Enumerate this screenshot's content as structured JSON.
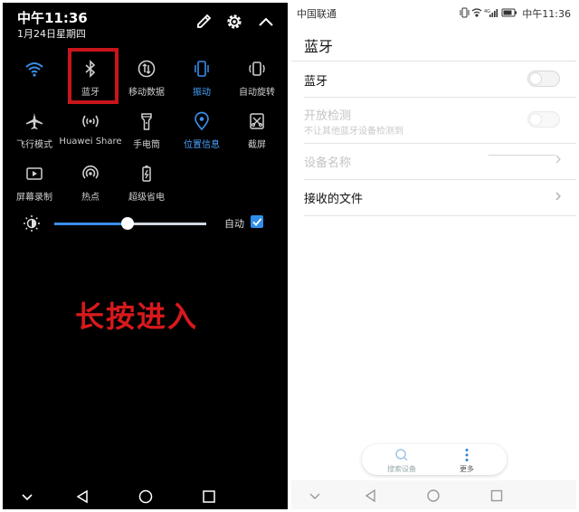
{
  "left": {
    "time": "中午11:36",
    "date": "1月24日星期四",
    "tiles": [
      {
        "label": "",
        "icon": "wifi-icon",
        "active": true
      },
      {
        "label": "蓝牙",
        "icon": "bluetooth-icon",
        "active": false
      },
      {
        "label": "移动数据",
        "icon": "mobile-data-icon",
        "active": false
      },
      {
        "label": "振动",
        "icon": "vibrate-icon",
        "active": true
      },
      {
        "label": "自动旋转",
        "icon": "rotate-icon",
        "active": false
      },
      {
        "label": "飞行模式",
        "icon": "airplane-icon",
        "active": false
      },
      {
        "label": "Huawei Share",
        "icon": "huawei-share-icon",
        "active": false
      },
      {
        "label": "手电筒",
        "icon": "flashlight-icon",
        "active": false
      },
      {
        "label": "位置信息",
        "icon": "location-icon",
        "active": true
      },
      {
        "label": "截屏",
        "icon": "screenshot-icon",
        "active": false
      },
      {
        "label": "屏幕录制",
        "icon": "screen-record-icon",
        "active": false
      },
      {
        "label": "热点",
        "icon": "hotspot-icon",
        "active": false
      },
      {
        "label": "超级省电",
        "icon": "power-saving-icon",
        "active": false
      }
    ],
    "brightness": {
      "level": 0.48,
      "auto_label": "自动",
      "auto_checked": true
    },
    "overlay_text": "长按进入",
    "accent_color": "#3a8eea",
    "highlight_color": "#c8151b"
  },
  "right": {
    "carrier": "中国联通",
    "time": "中午11:36",
    "title": "蓝牙",
    "rows": {
      "bluetooth": {
        "label": "蓝牙",
        "enabled": false
      },
      "open_detect": {
        "label": "开放检测",
        "sub": "不让其他蓝牙设备检测到",
        "enabled": false
      },
      "device_name": {
        "label": "设备名称"
      },
      "received_files": {
        "label": "接收的文件"
      }
    },
    "bottom_bar": {
      "search_label": "搜索设备",
      "more_label": "更多"
    }
  }
}
